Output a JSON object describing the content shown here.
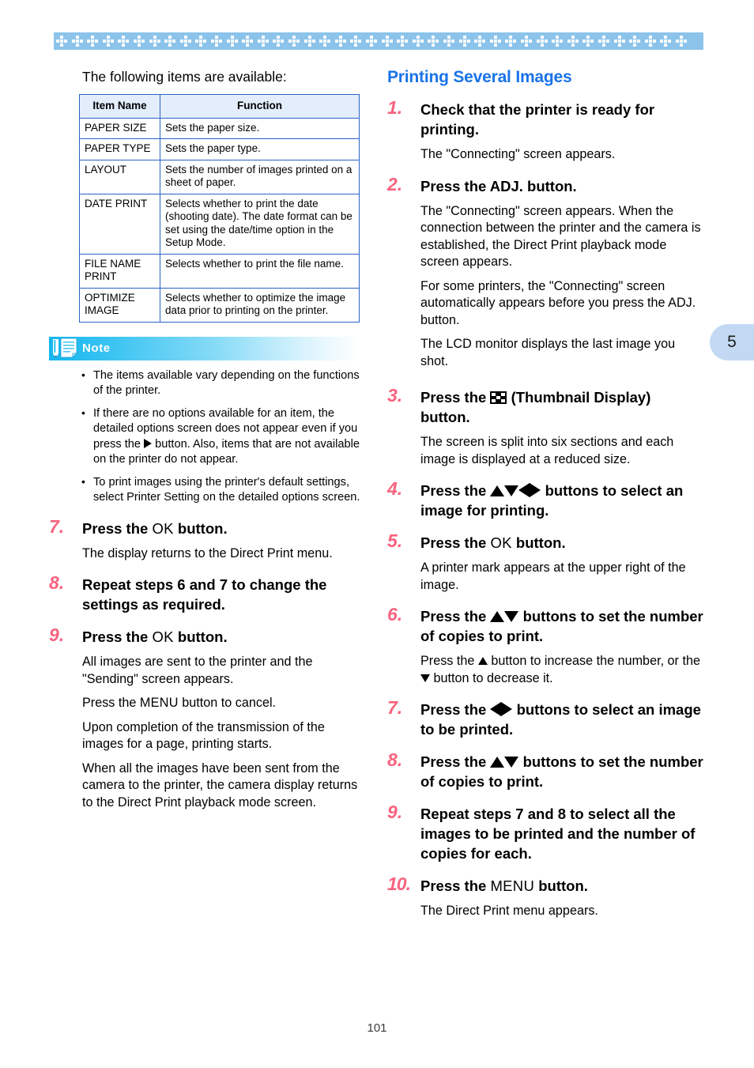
{
  "page": {
    "number": "101",
    "tab_number": "5",
    "chapter_tab_color": "#c3d9f3",
    "band_color": "#8cc3ea",
    "accent_number_color": "#f8637f",
    "heading_color": "#1a73e8"
  },
  "left": {
    "intro": "The following items are available:",
    "table": {
      "headers": [
        "Item Name",
        "Function"
      ],
      "rows": [
        {
          "name": "PAPER SIZE",
          "function": "Sets the paper size."
        },
        {
          "name": "PAPER TYPE",
          "function": "Sets the paper type."
        },
        {
          "name": "LAYOUT",
          "function": "Sets the number of images printed on a sheet of paper."
        },
        {
          "name": "DATE PRINT",
          "function": "Selects whether to print the date (shooting date). The date format can be set using the date/time option in the Setup Mode."
        },
        {
          "name": "FILE NAME PRINT",
          "function": "Selects whether to print the file name."
        },
        {
          "name": "OPTIMIZE IMAGE",
          "function": "Selects whether to optimize the image data prior to printing on the printer."
        }
      ]
    },
    "note": {
      "label": "Note",
      "icon": "note-document-pencil-icon",
      "bullets": [
        "The items available vary depending on the functions of the printer.",
        "If there are no options available for an item, the detailed options screen does not appear even if you press the ▶ button. Also, items that are not available on the printer do not appear.",
        "To print images using the printer's default settings, select Printer Setting on the detailed options screen."
      ],
      "bullet_2_parts": {
        "before": "If there are no options available for an item, the detailed options screen does not appear even if you press the ",
        "after": " button. Also, items that are not available on the printer do not appear."
      }
    },
    "steps": [
      {
        "num": "7.",
        "title_before": "Press the ",
        "title_key": "OK",
        "title_after": " button.",
        "body": [
          "The display returns to the Direct Print menu."
        ]
      },
      {
        "num": "8.",
        "title": "Repeat steps 6 and 7 to change the settings as required.",
        "body": []
      },
      {
        "num": "9.",
        "title_before": "Press the ",
        "title_key": "OK",
        "title_after": " button.",
        "body": [
          "All images are sent to the printer and the \"Sending\" screen appears.",
          "Upon completion of the transmission of the images for a page, printing starts.",
          "When all the images have been sent from the camera to the printer, the camera display returns to the Direct Print playback mode screen."
        ],
        "cancel_line": {
          "before": "Press the ",
          "key": "MENU",
          "after": " button to cancel."
        }
      }
    ]
  },
  "right": {
    "heading": "Printing Several Images",
    "steps": [
      {
        "num": "1.",
        "title": "Check that the printer is ready for printing.",
        "body": [
          "The \"Connecting\" screen appears."
        ]
      },
      {
        "num": "2.",
        "title": "Press the ADJ. button.",
        "body": [
          "The \"Connecting\" screen appears. When the connection between the printer and the camera is established, the Direct Print playback mode screen appears.",
          "For some printers, the \"Connecting\" screen automatically appears before you press the ADJ. button.",
          "The LCD monitor displays the last image you shot."
        ]
      },
      {
        "num": "3.",
        "title_before": "Press the ",
        "title_icon": "thumbnail-display-icon",
        "title_after": " (Thumbnail Display) button.",
        "body": [
          "The screen is split into six sections and each image is displayed at a reduced size."
        ]
      },
      {
        "num": "4.",
        "title_before": "Press the ",
        "title_icon": "arrow-up-down-left-right-icons",
        "title_after": " buttons to select an image for printing.",
        "body": []
      },
      {
        "num": "5.",
        "title_before": "Press the ",
        "title_key": "OK",
        "title_after": " button.",
        "body": [
          "A printer mark appears at the upper right of the image."
        ]
      },
      {
        "num": "6.",
        "title_before": "Press the ",
        "title_icon": "arrow-up-down-icons",
        "title_after": " buttons to set the number of copies to print.",
        "body_parts": {
          "p1": "Press the ",
          "p2": " button to increase the number, or the ",
          "p3": " button to decrease it."
        }
      },
      {
        "num": "7.",
        "title_before": "Press the ",
        "title_icon": "arrow-left-right-icons",
        "title_after": " buttons to select an image to be printed.",
        "body": []
      },
      {
        "num": "8.",
        "title_before": "Press the ",
        "title_icon": "arrow-up-down-icons",
        "title_after": " buttons to set the number of copies to print.",
        "body": []
      },
      {
        "num": "9.",
        "title": "Repeat steps 7 and 8 to select all the images to be printed and the number of copies for each.",
        "body": []
      },
      {
        "num": "10.",
        "title_before": "Press the ",
        "title_key": "MENU",
        "title_after": " button.",
        "body": [
          "The Direct Print menu appears."
        ]
      }
    ]
  }
}
